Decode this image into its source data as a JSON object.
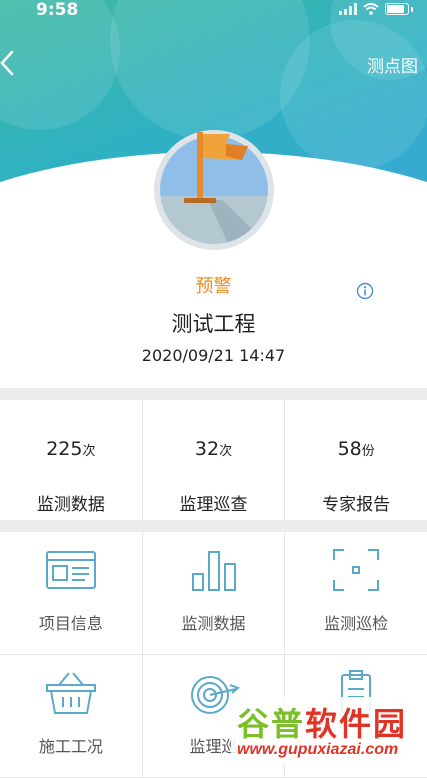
{
  "status_bar": {
    "time": "9:58"
  },
  "nav": {
    "right_link": "测点图"
  },
  "summary": {
    "status": "预警",
    "project_name": "测试工程",
    "datetime": "2020/09/21 14:47"
  },
  "stats": [
    {
      "value": "225",
      "unit": "次",
      "label": "监测数据"
    },
    {
      "value": "32",
      "unit": "次",
      "label": "监理巡查"
    },
    {
      "value": "58",
      "unit": "份",
      "label": "专家报告"
    }
  ],
  "menu": [
    {
      "label": "项目信息",
      "icon": "project-info-icon"
    },
    {
      "label": "监测数据",
      "icon": "bar-chart-icon"
    },
    {
      "label": "监测巡检",
      "icon": "scan-frame-icon"
    },
    {
      "label": "施工工况",
      "icon": "basket-icon"
    },
    {
      "label": "监理巡",
      "icon": "target-icon"
    },
    {
      "label": "",
      "icon": "clipboard-icon"
    }
  ],
  "watermark": {
    "title_part1": "谷普",
    "title_part2": "软件园",
    "url": "www.gupuxiazai.com"
  },
  "colors": {
    "accent": "#3fb4bf",
    "warning": "#ef8b1e",
    "icon": "#5aa9c8"
  }
}
